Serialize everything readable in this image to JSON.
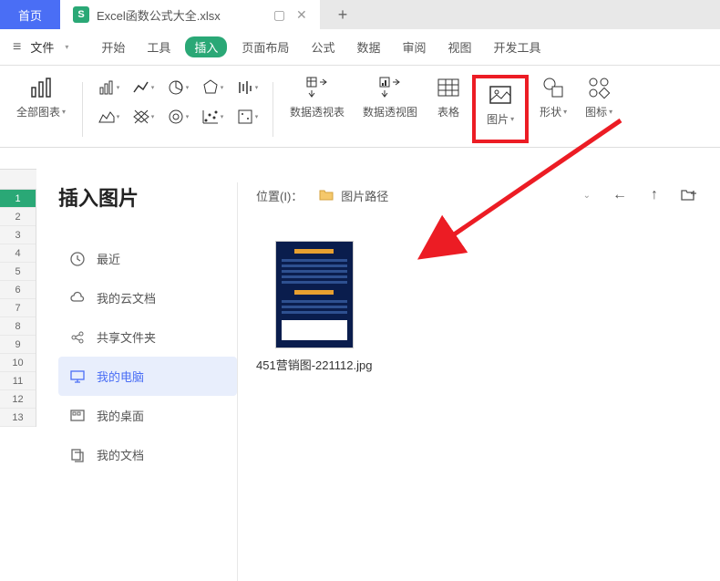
{
  "tabs": {
    "home": "首页",
    "file_title": "Excel函数公式大全.xlsx"
  },
  "menu": {
    "file": "文件",
    "items": [
      "开始",
      "工具",
      "插入",
      "页面布局",
      "公式",
      "数据",
      "审阅",
      "视图",
      "开发工具"
    ],
    "active_index": 2
  },
  "ribbon": {
    "all_charts": "全部图表",
    "pivot_table": "数据透视表",
    "pivot_view": "数据透视图",
    "table": "表格",
    "picture": "图片",
    "shape": "形状",
    "icons": "图标"
  },
  "dialog": {
    "title": "插入图片",
    "path_label": "位置(I)：",
    "path_text": "图片路径",
    "sidebar": [
      {
        "label": "最近",
        "key": "recent"
      },
      {
        "label": "我的云文档",
        "key": "cloud"
      },
      {
        "label": "共享文件夹",
        "key": "shared"
      },
      {
        "label": "我的电脑",
        "key": "computer"
      },
      {
        "label": "我的桌面",
        "key": "desktop"
      },
      {
        "label": "我的文档",
        "key": "documents"
      }
    ],
    "active_sidebar": 3,
    "files": [
      {
        "name": "451营销图-221112.jpg"
      }
    ]
  },
  "rows": [
    "1",
    "2",
    "3",
    "4",
    "5",
    "6",
    "7",
    "8",
    "9",
    "10",
    "11",
    "12",
    "13"
  ],
  "colors": {
    "primary": "#4a6ef5",
    "green": "#2aa876",
    "highlight": "#ec1c24"
  }
}
